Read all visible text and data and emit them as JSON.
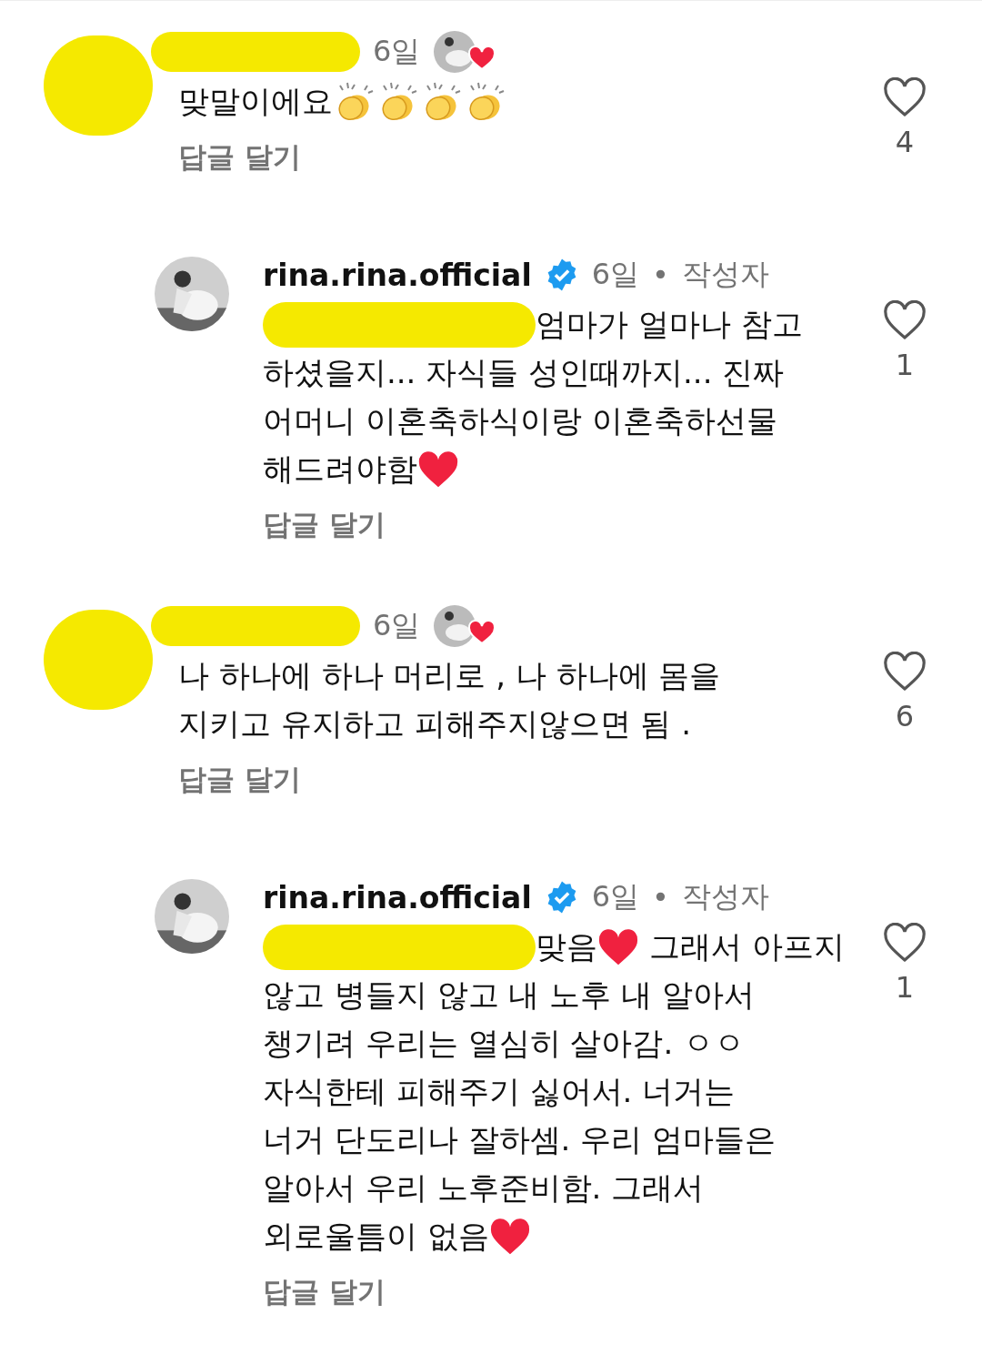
{
  "comments": [
    {
      "indent": false,
      "author_redacted": true,
      "verified": false,
      "time": "6일",
      "liked_by_author": true,
      "lines": [
        [
          {
            "kind": "text",
            "text": "맞말이에요"
          },
          {
            "kind": "clap"
          },
          {
            "kind": "clap"
          },
          {
            "kind": "clap"
          },
          {
            "kind": "clap"
          }
        ]
      ],
      "reply": "답글 달기",
      "likes": "4"
    },
    {
      "indent": true,
      "author_redacted": false,
      "author": "rina.rina.official",
      "verified": true,
      "time": "6일",
      "separator": "•",
      "author_tag": "작성자",
      "liked_by_author": false,
      "lines": [
        [
          {
            "kind": "redacted"
          },
          {
            "kind": "text",
            "text": "엄마가 얼마나 참고"
          }
        ],
        [
          {
            "kind": "text",
            "text": "하셨을지... 자식들 성인때까지... 진짜"
          }
        ],
        [
          {
            "kind": "text",
            "text": "어머니 이혼축하식이랑 이혼축하선물"
          }
        ],
        [
          {
            "kind": "text",
            "text": "해드려야함"
          },
          {
            "kind": "heart"
          }
        ]
      ],
      "reply": "답글 달기",
      "likes": "1"
    },
    {
      "indent": false,
      "author_redacted": true,
      "verified": false,
      "time": "6일",
      "liked_by_author": true,
      "lines": [
        [
          {
            "kind": "text",
            "text": "나 하나에 하나 머리로 , 나 하나에 몸을"
          }
        ],
        [
          {
            "kind": "text",
            "text": "지키고 유지하고 피해주지않으면 됨 ."
          }
        ]
      ],
      "reply": "답글 달기",
      "likes": "6"
    },
    {
      "indent": true,
      "author_redacted": false,
      "author": "rina.rina.official",
      "verified": true,
      "time": "6일",
      "separator": "•",
      "author_tag": "작성자",
      "liked_by_author": false,
      "lines": [
        [
          {
            "kind": "redacted"
          },
          {
            "kind": "text",
            "text": "맞음"
          },
          {
            "kind": "heart"
          },
          {
            "kind": "text",
            "text": " 그래서 아프지"
          }
        ],
        [
          {
            "kind": "text",
            "text": "않고 병들지 않고 내 노후 내 알아서"
          }
        ],
        [
          {
            "kind": "text",
            "text": "챙기려 우리는 열심히 살아감. ㅇㅇ"
          }
        ],
        [
          {
            "kind": "text",
            "text": "자식한테 피해주기 싫어서. 너거는"
          }
        ],
        [
          {
            "kind": "text",
            "text": "너거 단도리나 잘하셈. 우리 엄마들은"
          }
        ],
        [
          {
            "kind": "text",
            "text": "알아서 우리 노후준비함. 그래서"
          }
        ],
        [
          {
            "kind": "text",
            "text": "외로울틈이 없음"
          },
          {
            "kind": "heart"
          }
        ]
      ],
      "reply": "답글 달기",
      "likes": "1"
    }
  ]
}
